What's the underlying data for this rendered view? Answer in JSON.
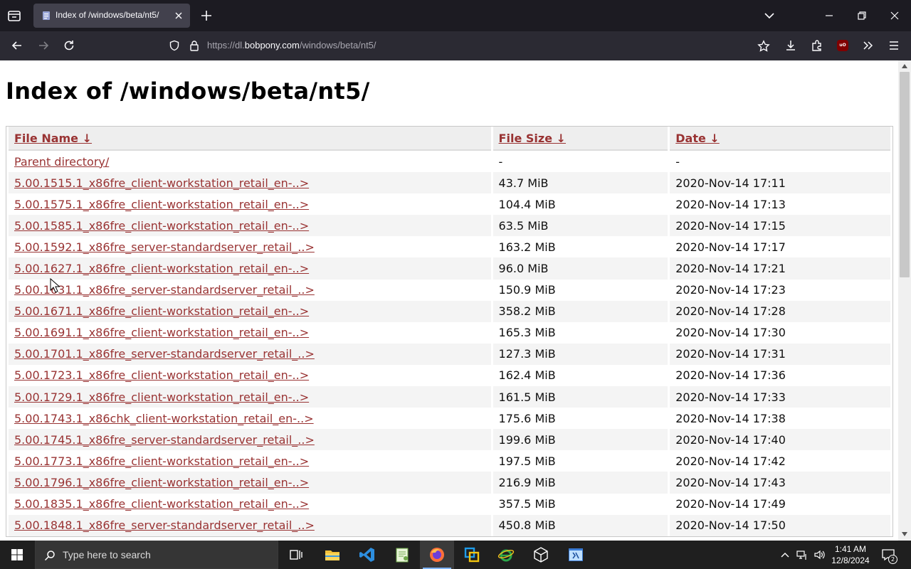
{
  "browser": {
    "tab_title": "Index of /windows/beta/nt5/",
    "url_scheme": "https://dl.",
    "url_host": "bobpony.com",
    "url_path": "/windows/beta/nt5/"
  },
  "page": {
    "title": "Index of /windows/beta/nt5/",
    "headers": {
      "name": "File Name  ↓",
      "size": "File Size  ↓",
      "date": "Date  ↓"
    },
    "rows": [
      {
        "name": "Parent directory/",
        "size": "-",
        "date": "-"
      },
      {
        "name": "5.00.1515.1_x86fre_client-workstation_retail_en-..>",
        "size": "43.7 MiB",
        "date": "2020-Nov-14 17:11"
      },
      {
        "name": "5.00.1575.1_x86fre_client-workstation_retail_en-..>",
        "size": "104.4 MiB",
        "date": "2020-Nov-14 17:13"
      },
      {
        "name": "5.00.1585.1_x86fre_client-workstation_retail_en-..>",
        "size": "63.5 MiB",
        "date": "2020-Nov-14 17:15"
      },
      {
        "name": "5.00.1592.1_x86fre_server-standardserver_retail_..>",
        "size": "163.2 MiB",
        "date": "2020-Nov-14 17:17"
      },
      {
        "name": "5.00.1627.1_x86fre_client-workstation_retail_en-..>",
        "size": "96.0 MiB",
        "date": "2020-Nov-14 17:21"
      },
      {
        "name": "5.00.1631.1_x86fre_server-standardserver_retail_..>",
        "size": "150.9 MiB",
        "date": "2020-Nov-14 17:23"
      },
      {
        "name": "5.00.1671.1_x86fre_client-workstation_retail_en-..>",
        "size": "358.2 MiB",
        "date": "2020-Nov-14 17:28"
      },
      {
        "name": "5.00.1691.1_x86fre_client-workstation_retail_en-..>",
        "size": "165.3 MiB",
        "date": "2020-Nov-14 17:30"
      },
      {
        "name": "5.00.1701.1_x86fre_server-standardserver_retail_..>",
        "size": "127.3 MiB",
        "date": "2020-Nov-14 17:31"
      },
      {
        "name": "5.00.1723.1_x86fre_client-workstation_retail_en-..>",
        "size": "162.4 MiB",
        "date": "2020-Nov-14 17:36"
      },
      {
        "name": "5.00.1729.1_x86fre_client-workstation_retail_en-..>",
        "size": "161.5 MiB",
        "date": "2020-Nov-14 17:33"
      },
      {
        "name": "5.00.1743.1_x86chk_client-workstation_retail_en-..>",
        "size": "175.6 MiB",
        "date": "2020-Nov-14 17:38"
      },
      {
        "name": "5.00.1745.1_x86fre_server-standardserver_retail_..>",
        "size": "199.6 MiB",
        "date": "2020-Nov-14 17:40"
      },
      {
        "name": "5.00.1773.1_x86fre_client-workstation_retail_en-..>",
        "size": "197.5 MiB",
        "date": "2020-Nov-14 17:42"
      },
      {
        "name": "5.00.1796.1_x86fre_client-workstation_retail_en-..>",
        "size": "216.9 MiB",
        "date": "2020-Nov-14 17:43"
      },
      {
        "name": "5.00.1835.1_x86fre_client-workstation_retail_en-..>",
        "size": "357.5 MiB",
        "date": "2020-Nov-14 17:49"
      },
      {
        "name": "5.00.1848.1_x86fre_server-standardserver_retail_..>",
        "size": "450.8 MiB",
        "date": "2020-Nov-14 17:50"
      }
    ]
  },
  "taskbar": {
    "search_placeholder": "Type here to search",
    "time": "1:41 AM",
    "date": "12/8/2024",
    "notification_count": "2"
  },
  "icons": {
    "tab_favicon": "page-icon",
    "tabs_list": "tab-list-icon",
    "shield": "tracking-protection-shield-icon",
    "lock": "lock-icon",
    "bookmark": "star-icon",
    "downloads": "download-icon",
    "extensions": "extensions-icon",
    "ublock": "ublock-origin-icon",
    "overflow": "chevron-double-right-icon",
    "menu": "hamburger-icon"
  },
  "colors": {
    "link": "#993333",
    "header_bg": "#eeeeee",
    "row_alt_bg": "#f4f4f4",
    "chrome_dark": "#1c1b22",
    "navbar": "#2b2a33",
    "tab_active": "#42414d",
    "taskbar": "#1f1f1f"
  }
}
